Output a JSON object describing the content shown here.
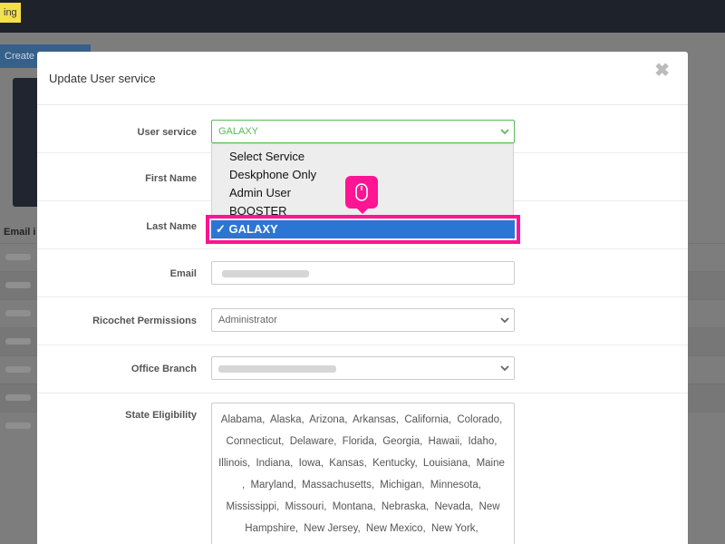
{
  "background": {
    "badge_text": "ing",
    "create_button": "Create",
    "email_header": "Email i"
  },
  "modal": {
    "title": "Update User service",
    "close_symbol": "✖",
    "fields": {
      "user_service": {
        "label": "User service",
        "value": "GALAXY",
        "options": [
          "Select Service",
          "Deskphone Only",
          "Admin User",
          "BOOSTER",
          "GALAXY"
        ],
        "selected_display": "✓ GALAXY"
      },
      "first_name": {
        "label": "First Name"
      },
      "last_name": {
        "label": "Last Name"
      },
      "email": {
        "label": "Email"
      },
      "ricochet_permissions": {
        "label": "Ricochet Permissions",
        "value": "Administrator"
      },
      "office_branch": {
        "label": "Office Branch"
      },
      "state_eligibility": {
        "label": "State Eligibility",
        "states": [
          "Alabama,",
          "Alaska,",
          "Arizona,",
          "Arkansas,",
          "California,",
          "Colorado,",
          "Connecticut,",
          "Delaware,",
          "Florida,",
          "Georgia,",
          "Hawaii,",
          "Idaho,",
          "Illinois,",
          "Indiana,",
          "Iowa,",
          "Kansas,",
          "Kentucky,",
          "Louisiana,",
          "Maine",
          ",",
          "Maryland,",
          "Massachusetts,",
          "Michigan,",
          "Minnesota,",
          "Mississippi,",
          "Missouri,",
          "Montana,",
          "Nebraska,",
          "Nevada,",
          "New Hampshire,",
          "New Jersey,",
          "New Mexico,",
          "New York,"
        ]
      }
    }
  },
  "colors": {
    "accent_green": "#5cb85c",
    "highlight_pink": "#ff1493",
    "selected_blue": "#2b76d3"
  },
  "icons": {
    "close": "close-icon",
    "caret": "chevron-down-icon",
    "mouse": "mouse-click-icon"
  }
}
